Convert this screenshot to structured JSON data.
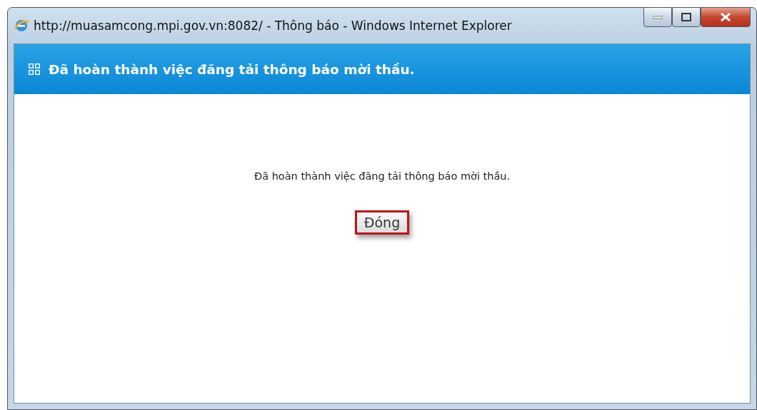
{
  "window": {
    "title": "http://muasamcong.mpi.gov.vn:8082/ - Thông báo - Windows Internet Explorer"
  },
  "header": {
    "title": "Đã hoàn thành việc đăng tải thông báo mời thầu."
  },
  "message": "Đã hoàn thành việc đăng tải thông báo mời thầu.",
  "buttons": [
    {
      "label": "Đóng",
      "highlighted": true
    }
  ]
}
